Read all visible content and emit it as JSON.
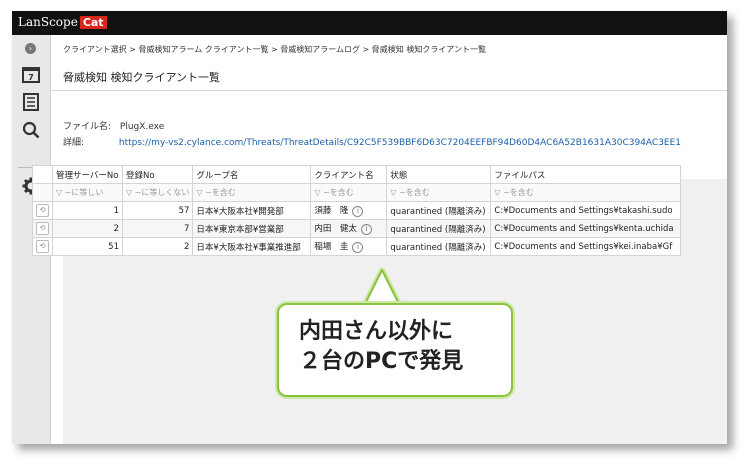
{
  "app": {
    "logo_text": "LanScope",
    "logo_badge": "Cat"
  },
  "breadcrumb": "クライアント選択 > 脅威検知アラーム クライアント一覧 > 脅威検知アラームログ > 脅威検知 検知クライアント一覧",
  "page_title": "脅威検知 検知クライアント一覧",
  "file": {
    "label": "ファイル名:",
    "value": "PlugX.exe"
  },
  "details": {
    "label": "詳細:",
    "url": "https://my-vs2.cylance.com/Threats/ThreatDetails/C92C5F539BBF6D63C7204EEFBF94D60D4AC6A52B1631A30C394AC3EE1"
  },
  "table": {
    "columns": [
      "管理サーバーNo",
      "登録No",
      "グループ名",
      "クライアント名",
      "状態",
      "ファイルパス"
    ],
    "filters": [
      "▽ ~に等しい",
      "▽ ~に等しくない",
      "▽ ~を含む",
      "▽ ~を含む",
      "▽ ~を含む",
      "▽ ~を含む"
    ],
    "rows": [
      {
        "server_no": "1",
        "reg_no": "57",
        "group": "日本¥大阪本社¥開発部",
        "client": "須藤　隆",
        "status": "quarantined (隔離済み)",
        "path": "C:¥Documents and Settings¥takashi.sudo"
      },
      {
        "server_no": "2",
        "reg_no": "7",
        "group": "日本¥東京本部¥営業部",
        "client": "内田　健太",
        "status": "quarantined (隔離済み)",
        "path": "C:¥Documents and Settings¥kenta.uchida"
      },
      {
        "server_no": "51",
        "reg_no": "2",
        "group": "日本¥大阪本社¥事業推進部",
        "client": "稲場　圭",
        "status": "quarantined (隔離済み)",
        "path": "C:¥Documents and Settings¥kei.inaba¥Gf"
      }
    ]
  },
  "callout": {
    "line1": "内田さん以外に",
    "line2": "２台のPCで発見"
  },
  "colors": {
    "topbar": "#111111",
    "logo_badge": "#d9261c",
    "link": "#1b5fa8",
    "callout_border": "#8ac43f"
  },
  "icons": {
    "collapse": "chevron-right-icon",
    "calendar": "calendar-icon",
    "report": "document-icon",
    "search": "search-icon",
    "settings": "gear-icon",
    "history": "history-icon",
    "info": "info-icon"
  }
}
